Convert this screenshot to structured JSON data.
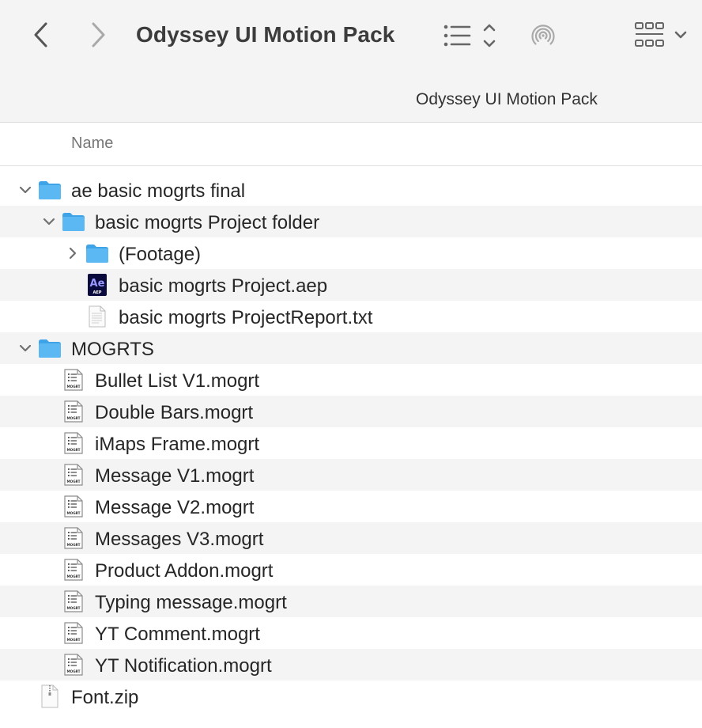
{
  "toolbar": {
    "back_icon": "chevron-left-icon",
    "forward_icon": "chevron-right-icon",
    "title": "Odyssey UI Motion Pack",
    "list_view_icon": "list-view-icon",
    "airdrop_icon": "airdrop-icon",
    "grid_view_icon": "grid-view-icon"
  },
  "path_bar": {
    "title": "Odyssey UI Motion Pack"
  },
  "columns": {
    "name": "Name"
  },
  "colors": {
    "folder": "#5cb8f3",
    "folder_dark": "#3fa3e8",
    "ae_bg": "#0a0a3c",
    "ae_text": "#9999ff"
  },
  "files": [
    {
      "label": "ae basic mogrts final",
      "kind": "folder",
      "expanded": true
    },
    {
      "label": "basic mogrts Project folder",
      "kind": "folder",
      "expanded": true
    },
    {
      "label": "(Footage)",
      "kind": "folder",
      "expanded": false
    },
    {
      "label": "basic mogrts Project.aep",
      "kind": "aep",
      "icon_text": "Ae",
      "icon_sub": "AEP"
    },
    {
      "label": "basic mogrts ProjectReport.txt",
      "kind": "txt"
    },
    {
      "label": "MOGRTS",
      "kind": "folder",
      "expanded": true
    },
    {
      "label": "Bullet List V1.mogrt",
      "kind": "mogrt",
      "icon_text": "MOGRT"
    },
    {
      "label": "Double Bars.mogrt",
      "kind": "mogrt",
      "icon_text": "MOGRT"
    },
    {
      "label": "iMaps Frame.mogrt",
      "kind": "mogrt",
      "icon_text": "MOGRT"
    },
    {
      "label": "Message V1.mogrt",
      "kind": "mogrt",
      "icon_text": "MOGRT"
    },
    {
      "label": "Message V2.mogrt",
      "kind": "mogrt",
      "icon_text": "MOGRT"
    },
    {
      "label": "Messages V3.mogrt",
      "kind": "mogrt",
      "icon_text": "MOGRT"
    },
    {
      "label": "Product Addon.mogrt",
      "kind": "mogrt",
      "icon_text": "MOGRT"
    },
    {
      "label": "Typing message.mogrt",
      "kind": "mogrt",
      "icon_text": "MOGRT"
    },
    {
      "label": "YT Comment.mogrt",
      "kind": "mogrt",
      "icon_text": "MOGRT"
    },
    {
      "label": "YT Notification.mogrt",
      "kind": "mogrt",
      "icon_text": "MOGRT"
    },
    {
      "label": "Font.zip",
      "kind": "zip"
    }
  ]
}
